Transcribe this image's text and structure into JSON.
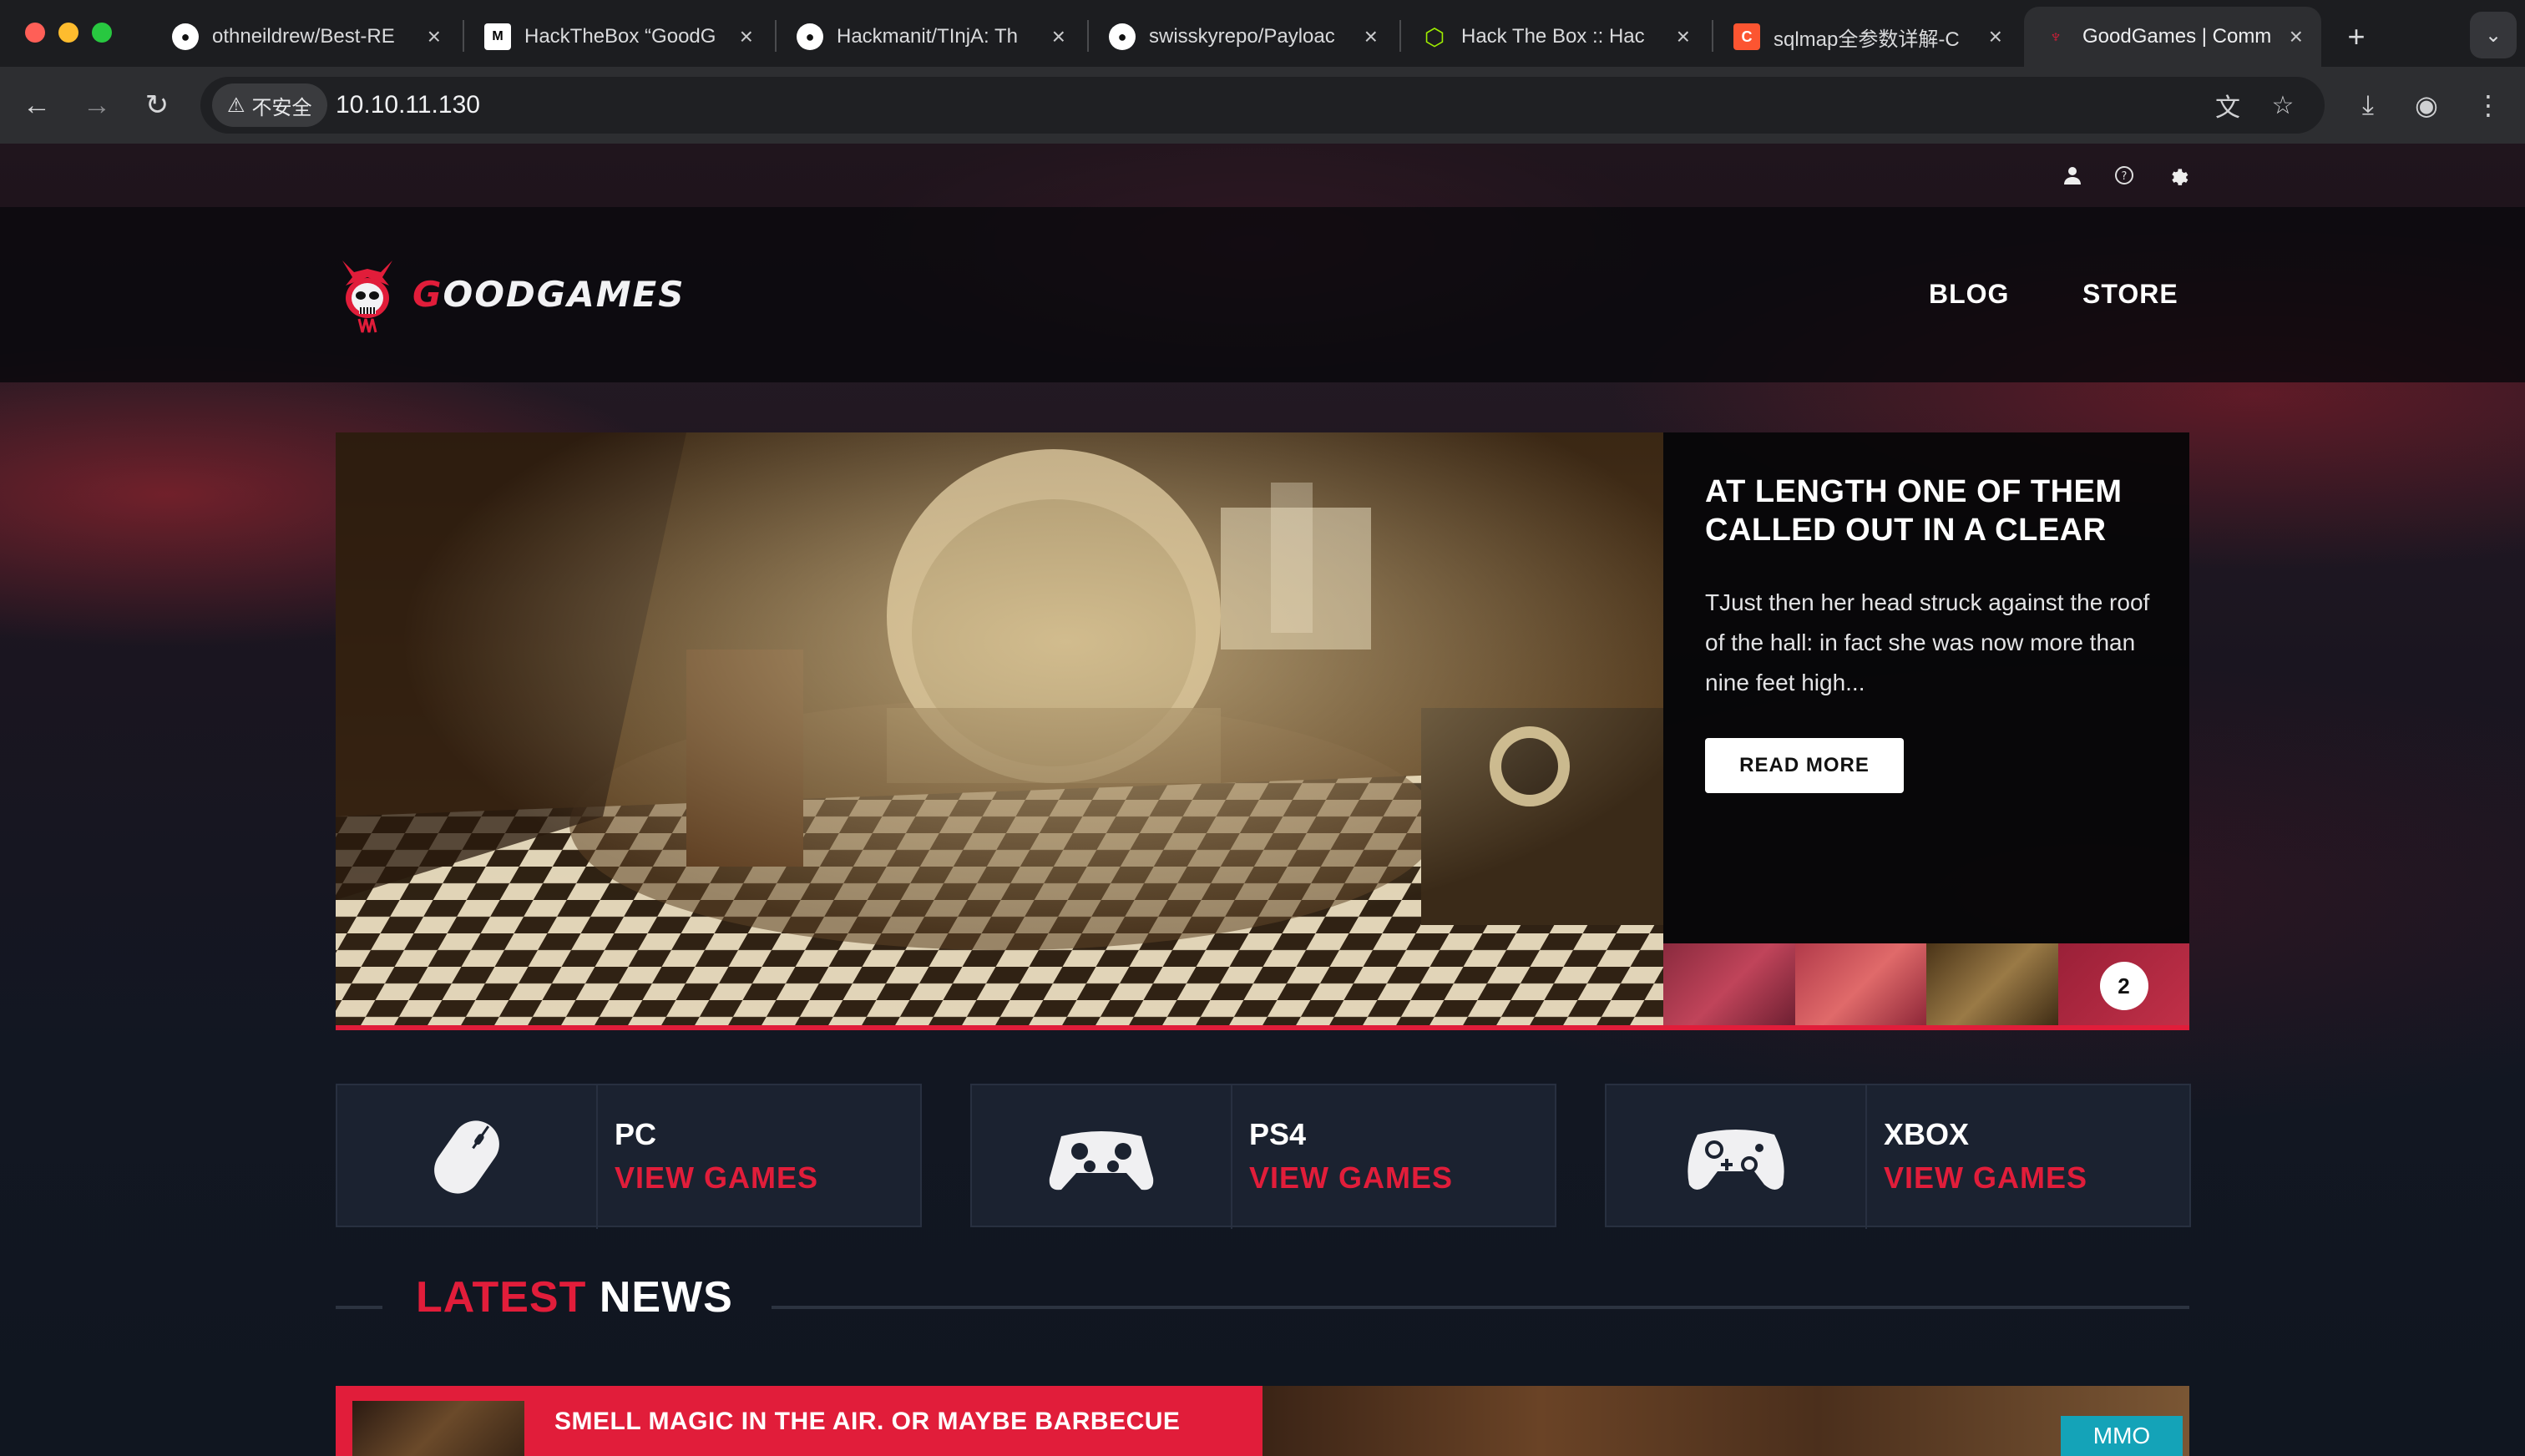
{
  "browser": {
    "tabs": [
      {
        "label": "othneildrew/Best-RE",
        "icon": "github-icon"
      },
      {
        "label": "HackTheBox “GoodG",
        "icon": "medium-icon"
      },
      {
        "label": "Hackmanit/TInjA: Th",
        "icon": "github-icon"
      },
      {
        "label": "swisskyrepo/Payloac",
        "icon": "github-icon"
      },
      {
        "label": "Hack The Box :: Hac",
        "icon": "htb-cube-icon"
      },
      {
        "label": "sqlmap全参数详解-C",
        "icon": "csdn-icon"
      },
      {
        "label": "GoodGames | Comm",
        "icon": "goodgames-favicon",
        "active": true
      }
    ],
    "security_label": "不安全",
    "url": "10.10.11.130",
    "favicon_glyphs": {
      "medium": "M̶",
      "csdn": "C"
    }
  },
  "site": {
    "brand_prefix": "G",
    "brand_text": "OODGAMES",
    "brand_g2": "G",
    "brand_tail": "AMES",
    "nav": [
      "BLOG",
      "STORE"
    ]
  },
  "hero": {
    "title": "AT LENGTH ONE OF THEM CALLED OUT IN A CLEAR",
    "text": "TJust then her head struck against the roof of the hall: in fact she was now more than nine feet high...",
    "button": "READ MORE",
    "active_slide": "2"
  },
  "categories": [
    {
      "name": "PC",
      "link": "VIEW GAMES",
      "icon": "mouse-icon"
    },
    {
      "name": "PS4",
      "link": "VIEW GAMES",
      "icon": "ps4-controller-icon"
    },
    {
      "name": "XBOX",
      "link": "VIEW GAMES",
      "icon": "xbox-controller-icon"
    }
  ],
  "news": {
    "title_accent": "LATEST",
    "title_rest": "NEWS",
    "items": [
      {
        "headline": "SMELL MAGIC IN THE AIR. OR MAYBE BARBECUE",
        "tag": "MMO"
      }
    ]
  },
  "colors": {
    "accent": "#e11d3a",
    "tag": "#14a3b8",
    "card": "#1b2230"
  }
}
